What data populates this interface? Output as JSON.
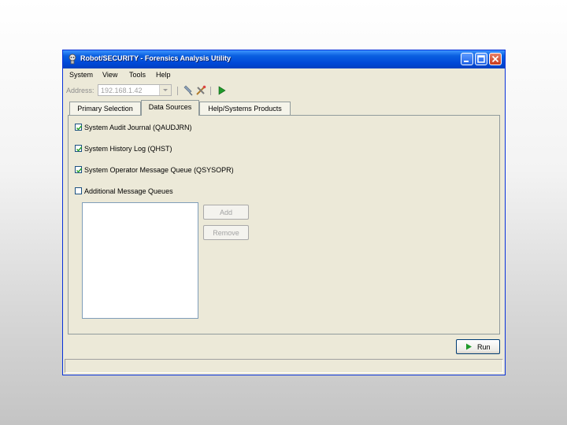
{
  "window": {
    "title": "Robot/SECURITY - Forensics Analysis Utility"
  },
  "menu": {
    "items": [
      "System",
      "View",
      "Tools",
      "Help"
    ]
  },
  "address": {
    "label": "Address:",
    "value": "192.168.1.42"
  },
  "tabs": [
    {
      "label": "Primary Selection",
      "active": false
    },
    {
      "label": "Data Sources",
      "active": true
    },
    {
      "label": "Help/Systems Products",
      "active": false
    }
  ],
  "data_sources": {
    "checkboxes": [
      {
        "label": "System Audit Journal (QAUDJRN)",
        "checked": true
      },
      {
        "label": "System History Log (QHST)",
        "checked": true
      },
      {
        "label": "System Operator Message Queue (QSYSOPR)",
        "checked": true
      },
      {
        "label": "Additional Message Queues",
        "checked": false
      }
    ],
    "add_label": "Add",
    "remove_label": "Remove"
  },
  "footer": {
    "run_label": "Run"
  },
  "icons": {
    "app": "robot-icon",
    "toolbar": [
      "disconnect-icon",
      "tools-icon",
      "run-icon"
    ]
  },
  "colors": {
    "titlebar": "#0a5fe0",
    "window_bg": "#ece9d8",
    "run_green": "#1f9a2a"
  }
}
